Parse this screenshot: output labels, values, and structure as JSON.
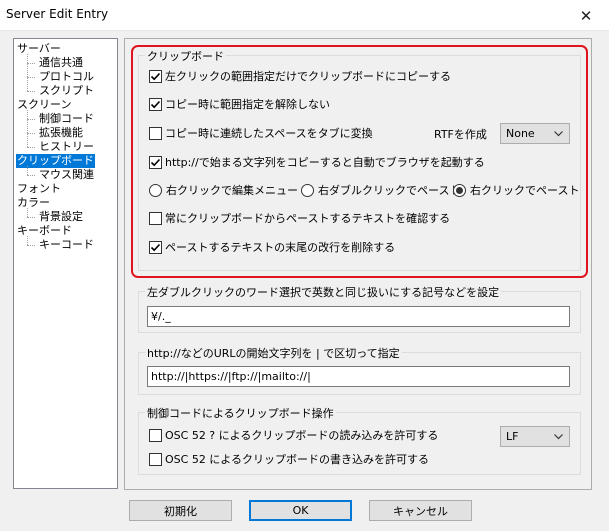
{
  "window": {
    "title": "Server Edit Entry",
    "close_glyph": "✕"
  },
  "tree": {
    "items": [
      {
        "label": "サーバー",
        "level": 0,
        "selected": false
      },
      {
        "label": "通信共通",
        "level": 1,
        "selected": false
      },
      {
        "label": "プロトコル",
        "level": 1,
        "selected": false
      },
      {
        "label": "スクリプト",
        "level": 1,
        "selected": false
      },
      {
        "label": "スクリーン",
        "level": 0,
        "selected": false
      },
      {
        "label": "制御コード",
        "level": 1,
        "selected": false
      },
      {
        "label": "拡張機能",
        "level": 1,
        "selected": false
      },
      {
        "label": "ヒストリー",
        "level": 1,
        "selected": false
      },
      {
        "label": "クリップボード",
        "level": 0,
        "selected": true
      },
      {
        "label": "マウス関連",
        "level": 1,
        "selected": false
      },
      {
        "label": "フォント",
        "level": 0,
        "selected": false
      },
      {
        "label": "カラー",
        "level": 0,
        "selected": false
      },
      {
        "label": "背景設定",
        "level": 1,
        "selected": false
      },
      {
        "label": "キーボード",
        "level": 0,
        "selected": false
      },
      {
        "label": "キーコード",
        "level": 1,
        "selected": false
      }
    ]
  },
  "clipboard": {
    "group_label": "クリップボード",
    "cb1": {
      "label": "左クリックの範囲指定だけでクリップボードにコピーする",
      "checked": true
    },
    "cb2": {
      "label": "コピー時に範囲指定を解除しない",
      "checked": true
    },
    "cb3": {
      "label": "コピー時に連続したスペースをタブに変換",
      "checked": false
    },
    "rtf_label": "RTFを作成",
    "rtf_value": "None",
    "cb4": {
      "label": "http://で始まる文字列をコピーすると自動でブラウザを起動する",
      "checked": true
    },
    "radio1": {
      "label": "右クリックで編集メニュー",
      "checked": false
    },
    "radio2": {
      "label": "右ダブルクリックでペースト",
      "checked": false
    },
    "radio3": {
      "label": "右クリックでペースト",
      "checked": true
    },
    "cb5": {
      "label": "常にクリップボードからペーストするテキストを確認する",
      "checked": false
    },
    "cb6": {
      "label": "ペーストするテキストの末尾の改行を削除する",
      "checked": true
    }
  },
  "word_group": {
    "label": "左ダブルクリックのワード選択で英数と同じ扱いにする記号などを設定",
    "value": "¥/._"
  },
  "url_group": {
    "label": "http://などのURLの開始文字列を | で区切って指定",
    "value": "http://|https://|ftp://|mailto://|"
  },
  "ctrl_group": {
    "label": "制御コードによるクリップボード操作",
    "cb1": {
      "label": "OSC 52 ? によるクリップボードの読み込みを許可する",
      "checked": false
    },
    "cb2": {
      "label": "OSC 52 によるクリップボードの書き込みを許可する",
      "checked": false
    },
    "select_value": "LF"
  },
  "buttons": {
    "init": "初期化",
    "ok": "OK",
    "cancel": "キャンセル"
  }
}
